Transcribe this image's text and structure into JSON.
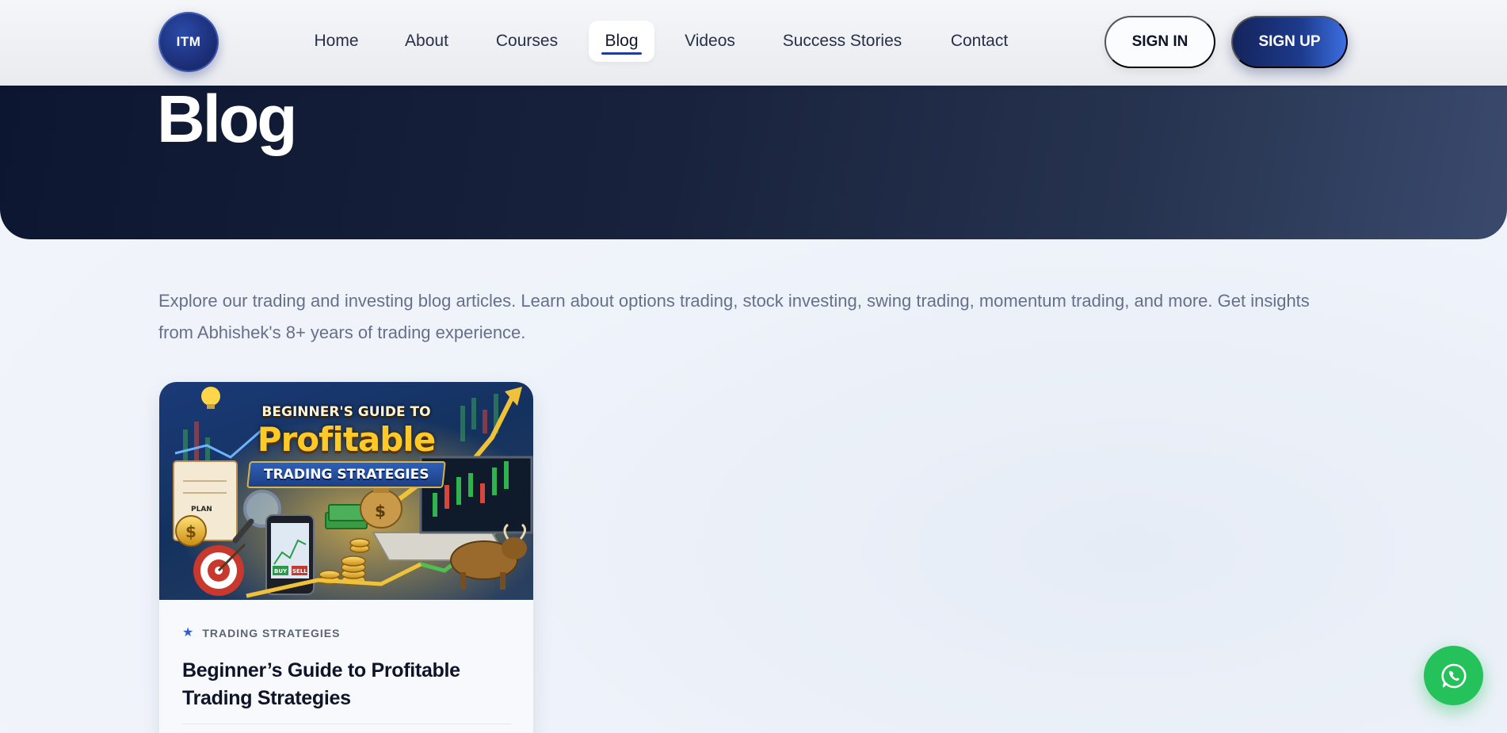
{
  "brand": {
    "logo_text": "ITM"
  },
  "nav": {
    "items": [
      {
        "label": "Home"
      },
      {
        "label": "About"
      },
      {
        "label": "Courses"
      },
      {
        "label": "Blog",
        "active": true
      },
      {
        "label": "Videos"
      },
      {
        "label": "Success Stories"
      },
      {
        "label": "Contact"
      }
    ],
    "sign_in": "SIGN IN",
    "sign_up": "SIGN UP"
  },
  "hero": {
    "title": "Blog"
  },
  "intro": {
    "text": "Explore our trading and investing blog articles. Learn about options trading, stock investing, swing trading, momentum trading, and more. Get insights from Abhishek's 8+ years of trading experience."
  },
  "posts": [
    {
      "image": {
        "line1": "BEGINNER'S GUIDE TO",
        "line2": "Profitable",
        "line3": "TRADING STRATEGIES",
        "plan_label": "PLAN",
        "buy_label": "BUY",
        "sell_label": "SELL"
      },
      "category": "TRADING STRATEGIES",
      "title": "Beginner’s Guide to Profitable Trading Strategies"
    }
  ],
  "colors": {
    "brand_dark": "#14245c",
    "brand_accent": "#3c6fe0",
    "whatsapp": "#25c15b",
    "hero_dark": "#0c1630"
  },
  "icons": {
    "category": "star-icon",
    "chat": "whatsapp-icon"
  }
}
